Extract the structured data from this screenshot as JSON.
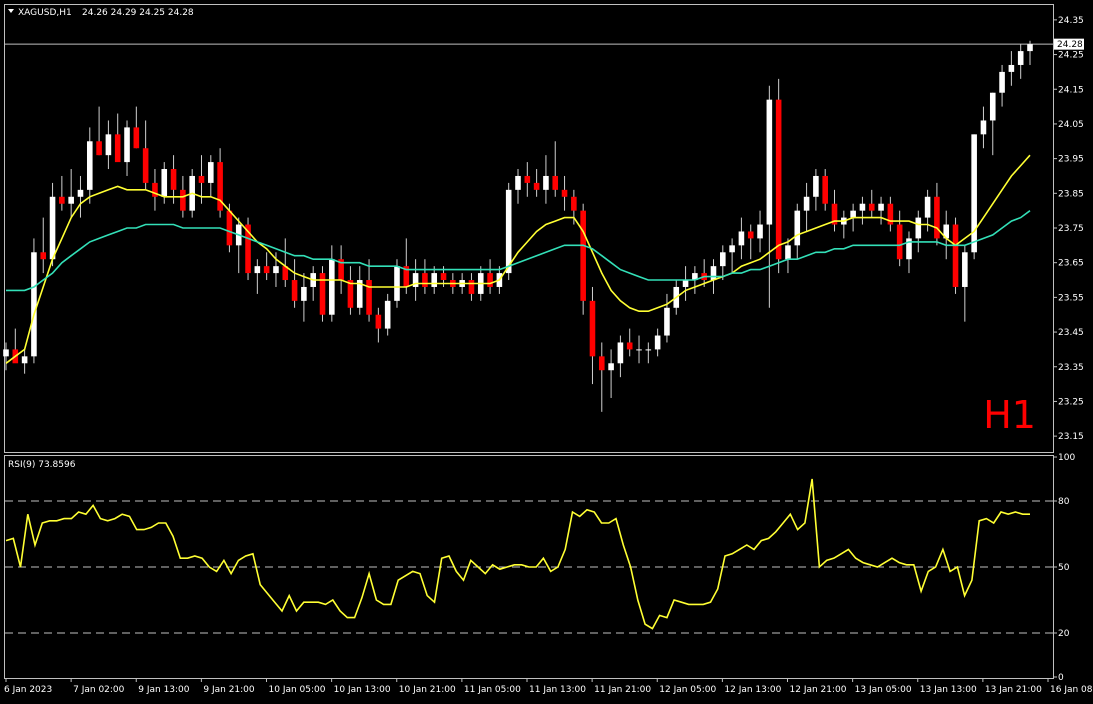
{
  "header": {
    "dropdown_icon": "triangle-down-icon",
    "symbol": "XAGUSD,H1",
    "ohlc": "24.26 24.29 24.25 24.28"
  },
  "watermark": "H1",
  "rsi_label": "RSI(9) 73.8596",
  "price_tag": "24.28",
  "colors": {
    "background": "#000000",
    "grid": "#c0c0c0",
    "bull_candle": "#ffffff",
    "bear_candle": "#ff0000",
    "wick": "#d0d0d0",
    "ma_fast": "#ffff33",
    "ma_slow": "#33e0b8",
    "rsi": "#ffff33",
    "watermark": "#ff0000"
  },
  "chart_data": [
    {
      "type": "candlestick",
      "title": "XAGUSD,H1",
      "y_ticks": [
        "24.35",
        "24.25",
        "24.15",
        "24.05",
        "23.95",
        "23.85",
        "23.75",
        "23.65",
        "23.55",
        "23.45",
        "23.35",
        "23.25",
        "23.15"
      ],
      "ylim": [
        23.11,
        24.39
      ],
      "x_tick_labels": [
        "6 Jan 2023",
        "7 Jan 02:00",
        "9 Jan 13:00",
        "9 Jan 21:00",
        "10 Jan 05:00",
        "10 Jan 13:00",
        "10 Jan 21:00",
        "11 Jan 05:00",
        "11 Jan 13:00",
        "11 Jan 21:00",
        "12 Jan 05:00",
        "12 Jan 13:00",
        "12 Jan 21:00",
        "13 Jan 05:00",
        "13 Jan 13:00",
        "13 Jan 21:00",
        "16 Jan 08:00"
      ],
      "last_price": 24.28,
      "candles": [
        [
          23.38,
          23.42,
          23.34,
          23.4
        ],
        [
          23.4,
          23.46,
          23.38,
          23.36
        ],
        [
          23.36,
          23.4,
          23.33,
          23.38
        ],
        [
          23.38,
          23.72,
          23.36,
          23.68
        ],
        [
          23.68,
          23.78,
          23.62,
          23.66
        ],
        [
          23.66,
          23.88,
          23.64,
          23.84
        ],
        [
          23.84,
          23.9,
          23.8,
          23.82
        ],
        [
          23.82,
          23.92,
          23.78,
          23.84
        ],
        [
          23.84,
          23.9,
          23.78,
          23.86
        ],
        [
          23.86,
          24.04,
          23.82,
          24.0
        ],
        [
          24.0,
          24.1,
          23.96,
          23.96
        ],
        [
          23.96,
          24.06,
          23.92,
          24.02
        ],
        [
          24.02,
          24.08,
          23.98,
          23.94
        ],
        [
          23.94,
          24.06,
          23.9,
          24.04
        ],
        [
          24.04,
          24.1,
          23.98,
          23.98
        ],
        [
          23.98,
          24.06,
          23.86,
          23.88
        ],
        [
          23.88,
          23.92,
          23.8,
          23.84
        ],
        [
          23.84,
          23.94,
          23.82,
          23.92
        ],
        [
          23.92,
          23.96,
          23.82,
          23.86
        ],
        [
          23.86,
          23.9,
          23.78,
          23.8
        ],
        [
          23.8,
          23.92,
          23.78,
          23.9
        ],
        [
          23.9,
          23.96,
          23.82,
          23.88
        ],
        [
          23.88,
          23.96,
          23.84,
          23.94
        ],
        [
          23.94,
          23.98,
          23.78,
          23.8
        ],
        [
          23.8,
          23.82,
          23.68,
          23.7
        ],
        [
          23.7,
          23.78,
          23.62,
          23.76
        ],
        [
          23.76,
          23.78,
          23.6,
          23.62
        ],
        [
          23.62,
          23.66,
          23.56,
          23.64
        ],
        [
          23.64,
          23.68,
          23.6,
          23.62
        ],
        [
          23.62,
          23.68,
          23.58,
          23.64
        ],
        [
          23.64,
          23.72,
          23.58,
          23.6
        ],
        [
          23.6,
          23.66,
          23.52,
          23.54
        ],
        [
          23.54,
          23.62,
          23.48,
          23.58
        ],
        [
          23.58,
          23.64,
          23.54,
          23.62
        ],
        [
          23.62,
          23.64,
          23.48,
          23.5
        ],
        [
          23.5,
          23.7,
          23.48,
          23.66
        ],
        [
          23.66,
          23.7,
          23.56,
          23.6
        ],
        [
          23.6,
          23.64,
          23.5,
          23.52
        ],
        [
          23.52,
          23.64,
          23.5,
          23.6
        ],
        [
          23.6,
          23.66,
          23.48,
          23.5
        ],
        [
          23.5,
          23.52,
          23.42,
          23.46
        ],
        [
          23.46,
          23.56,
          23.44,
          23.54
        ],
        [
          23.54,
          23.66,
          23.52,
          23.64
        ],
        [
          23.64,
          23.72,
          23.56,
          23.58
        ],
        [
          23.58,
          23.66,
          23.54,
          23.62
        ],
        [
          23.62,
          23.66,
          23.56,
          23.58
        ],
        [
          23.58,
          23.64,
          23.56,
          23.62
        ],
        [
          23.62,
          23.64,
          23.58,
          23.6
        ],
        [
          23.6,
          23.62,
          23.56,
          23.58
        ],
        [
          23.58,
          23.62,
          23.56,
          23.6
        ],
        [
          23.6,
          23.62,
          23.54,
          23.56
        ],
        [
          23.56,
          23.64,
          23.54,
          23.62
        ],
        [
          23.62,
          23.66,
          23.56,
          23.58
        ],
        [
          23.58,
          23.64,
          23.56,
          23.62
        ],
        [
          23.62,
          23.88,
          23.6,
          23.86
        ],
        [
          23.86,
          23.92,
          23.82,
          23.9
        ],
        [
          23.9,
          23.94,
          23.84,
          23.88
        ],
        [
          23.88,
          23.92,
          23.84,
          23.86
        ],
        [
          23.86,
          23.96,
          23.82,
          23.9
        ],
        [
          23.9,
          24.0,
          23.84,
          23.86
        ],
        [
          23.86,
          23.9,
          23.8,
          23.84
        ],
        [
          23.84,
          23.86,
          23.76,
          23.8
        ],
        [
          23.8,
          23.82,
          23.5,
          23.54
        ],
        [
          23.54,
          23.58,
          23.3,
          23.38
        ],
        [
          23.38,
          23.42,
          23.22,
          23.34
        ],
        [
          23.34,
          23.4,
          23.26,
          23.36
        ],
        [
          23.36,
          23.44,
          23.32,
          23.42
        ],
        [
          23.42,
          23.46,
          23.38,
          23.4
        ],
        [
          23.4,
          23.44,
          23.36,
          23.4
        ],
        [
          23.4,
          23.42,
          23.36,
          23.4
        ],
        [
          23.4,
          23.46,
          23.38,
          23.44
        ],
        [
          23.44,
          23.56,
          23.42,
          23.52
        ],
        [
          23.52,
          23.6,
          23.5,
          23.58
        ],
        [
          23.58,
          23.64,
          23.54,
          23.6
        ],
        [
          23.6,
          23.64,
          23.56,
          23.62
        ],
        [
          23.62,
          23.66,
          23.58,
          23.6
        ],
        [
          23.6,
          23.66,
          23.56,
          23.64
        ],
        [
          23.64,
          23.7,
          23.6,
          23.68
        ],
        [
          23.68,
          23.72,
          23.62,
          23.7
        ],
        [
          23.7,
          23.78,
          23.66,
          23.74
        ],
        [
          23.74,
          23.76,
          23.66,
          23.72
        ],
        [
          23.72,
          23.8,
          23.68,
          23.76
        ],
        [
          23.76,
          24.16,
          23.52,
          24.12
        ],
        [
          24.12,
          24.18,
          23.62,
          23.66
        ],
        [
          23.66,
          23.72,
          23.62,
          23.7
        ],
        [
          23.7,
          23.82,
          23.66,
          23.8
        ],
        [
          23.8,
          23.88,
          23.74,
          23.84
        ],
        [
          23.84,
          23.92,
          23.8,
          23.9
        ],
        [
          23.9,
          23.92,
          23.8,
          23.82
        ],
        [
          23.82,
          23.86,
          23.74,
          23.76
        ],
        [
          23.76,
          23.8,
          23.72,
          23.78
        ],
        [
          23.78,
          23.82,
          23.74,
          23.8
        ],
        [
          23.8,
          23.84,
          23.76,
          23.82
        ],
        [
          23.82,
          23.86,
          23.78,
          23.8
        ],
        [
          23.8,
          23.84,
          23.76,
          23.82
        ],
        [
          23.82,
          23.84,
          23.74,
          23.76
        ],
        [
          23.76,
          23.8,
          23.64,
          23.66
        ],
        [
          23.66,
          23.74,
          23.62,
          23.72
        ],
        [
          23.72,
          23.8,
          23.68,
          23.78
        ],
        [
          23.78,
          23.86,
          23.74,
          23.84
        ],
        [
          23.84,
          23.88,
          23.7,
          23.72
        ],
        [
          23.72,
          23.8,
          23.66,
          23.76
        ],
        [
          23.76,
          23.78,
          23.56,
          23.58
        ],
        [
          23.58,
          23.7,
          23.48,
          23.68
        ],
        [
          23.68,
          24.02,
          23.66,
          24.02
        ],
        [
          24.02,
          24.1,
          23.98,
          24.06
        ],
        [
          24.06,
          24.14,
          23.96,
          24.14
        ],
        [
          24.14,
          24.22,
          24.1,
          24.2
        ],
        [
          24.2,
          24.26,
          24.16,
          24.22
        ],
        [
          24.22,
          24.28,
          24.18,
          24.26
        ],
        [
          24.26,
          24.29,
          24.22,
          24.28
        ]
      ],
      "series": [
        {
          "name": "",
          "values": [
            23.36,
            23.38,
            23.4,
            23.5,
            23.58,
            23.66,
            23.72,
            23.78,
            23.82,
            23.84,
            23.85,
            23.86,
            23.87,
            23.86,
            23.86,
            23.86,
            23.85,
            23.84,
            23.84,
            23.84,
            23.85,
            23.84,
            23.84,
            23.83,
            23.8,
            23.77,
            23.74,
            23.71,
            23.69,
            23.66,
            23.64,
            23.62,
            23.61,
            23.6,
            23.6,
            23.6,
            23.6,
            23.59,
            23.59,
            23.58,
            23.58,
            23.58,
            23.58,
            23.58,
            23.59,
            23.59,
            23.59,
            23.59,
            23.59,
            23.59,
            23.59,
            23.59,
            23.59,
            23.6,
            23.64,
            23.68,
            23.71,
            23.74,
            23.76,
            23.77,
            23.78,
            23.78,
            23.74,
            23.68,
            23.62,
            23.57,
            23.54,
            23.52,
            23.51,
            23.51,
            23.52,
            23.53,
            23.55,
            23.57,
            23.58,
            23.59,
            23.6,
            23.61,
            23.62,
            23.64,
            23.65,
            23.66,
            23.68,
            23.7,
            23.71,
            23.73,
            23.74,
            23.75,
            23.76,
            23.77,
            23.77,
            23.78,
            23.78,
            23.78,
            23.78,
            23.77,
            23.77,
            23.77,
            23.76,
            23.76,
            23.75,
            23.72,
            23.7,
            23.72,
            23.74,
            23.78,
            23.82,
            23.86,
            23.9,
            23.93,
            23.96
          ]
        },
        {
          "name": "",
          "values": [
            23.57,
            23.57,
            23.57,
            23.58,
            23.6,
            23.62,
            23.65,
            23.67,
            23.69,
            23.71,
            23.72,
            23.73,
            23.74,
            23.75,
            23.75,
            23.76,
            23.76,
            23.76,
            23.76,
            23.75,
            23.75,
            23.75,
            23.75,
            23.75,
            23.74,
            23.73,
            23.72,
            23.71,
            23.7,
            23.69,
            23.68,
            23.67,
            23.67,
            23.66,
            23.66,
            23.66,
            23.65,
            23.65,
            23.65,
            23.64,
            23.64,
            23.64,
            23.64,
            23.63,
            23.63,
            23.63,
            23.63,
            23.63,
            23.63,
            23.63,
            23.63,
            23.63,
            23.63,
            23.63,
            23.64,
            23.65,
            23.66,
            23.67,
            23.68,
            23.69,
            23.7,
            23.7,
            23.7,
            23.69,
            23.67,
            23.65,
            23.63,
            23.62,
            23.61,
            23.6,
            23.6,
            23.6,
            23.6,
            23.6,
            23.6,
            23.61,
            23.61,
            23.61,
            23.62,
            23.62,
            23.63,
            23.63,
            23.64,
            23.65,
            23.66,
            23.66,
            23.67,
            23.68,
            23.68,
            23.69,
            23.69,
            23.7,
            23.7,
            23.7,
            23.7,
            23.7,
            23.7,
            23.71,
            23.71,
            23.71,
            23.71,
            23.7,
            23.7,
            23.7,
            23.71,
            23.72,
            23.73,
            23.75,
            23.77,
            23.78,
            23.8
          ]
        }
      ]
    },
    {
      "type": "line",
      "title": "RSI(9) 73.8596",
      "y_ticks": [
        "100",
        "80",
        "50",
        "20",
        "0"
      ],
      "ylim": [
        0,
        100
      ],
      "levels": [
        80,
        50,
        20
      ],
      "series": [
        {
          "name": "RSI(9)",
          "values": [
            62,
            63,
            50,
            74,
            60,
            70,
            71,
            71,
            72,
            72,
            75,
            74,
            78,
            72,
            71,
            72,
            74,
            73,
            67,
            67,
            68,
            70,
            70,
            64,
            54,
            54,
            55,
            54,
            50,
            48,
            53,
            47,
            53,
            55,
            56,
            42,
            38,
            34,
            30,
            37,
            30,
            34,
            34,
            34,
            33,
            35,
            30,
            27,
            27,
            36,
            47,
            35,
            33,
            33,
            44,
            46,
            48,
            47,
            37,
            34,
            54,
            55,
            48,
            44,
            53,
            50,
            47,
            51,
            49,
            50,
            51,
            51,
            50,
            50,
            54,
            48,
            50,
            58,
            75,
            73,
            76,
            75,
            70,
            70,
            72,
            60,
            50,
            35,
            24,
            22,
            28,
            27,
            35,
            34,
            33,
            33,
            33,
            34,
            40,
            55,
            56,
            58,
            60,
            58,
            62,
            63,
            66,
            70,
            74,
            67,
            70,
            90,
            50,
            53,
            54,
            56,
            58,
            54,
            52,
            51,
            50,
            52,
            54,
            52,
            51,
            51,
            39,
            48,
            50,
            58,
            48,
            50,
            37,
            44,
            71,
            72,
            70,
            75,
            74,
            75,
            74,
            74
          ]
        }
      ]
    }
  ]
}
